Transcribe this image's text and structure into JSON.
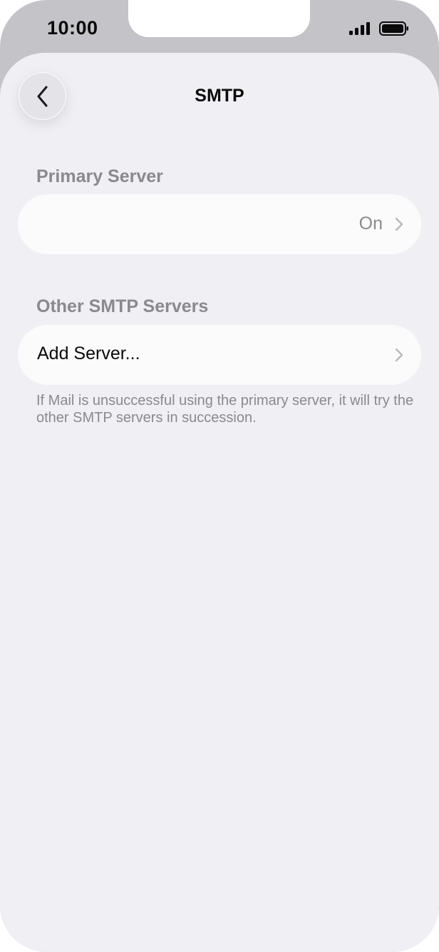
{
  "status_bar": {
    "time": "10:00"
  },
  "nav": {
    "back_icon": "chevron-left-icon",
    "title": "SMTP"
  },
  "primary_section": {
    "header": "Primary Server",
    "row": {
      "label": "",
      "value": "On"
    }
  },
  "other_section": {
    "header": "Other SMTP Servers",
    "row": {
      "label": "Add Server..."
    },
    "footer": "If Mail is unsuccessful using the primary server, it will try the other SMTP servers in succession."
  },
  "colors": {
    "background": "#f0eff4",
    "cell": "#fbfbfb",
    "secondary_text": "#8a8a8e",
    "primary_text": "#0a0a0a"
  }
}
